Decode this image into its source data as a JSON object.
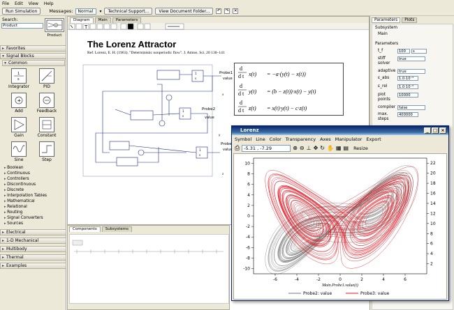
{
  "menu": [
    "File",
    "Edit",
    "View",
    "Help"
  ],
  "toolbar": {
    "run_label": "Run Simulation",
    "messages_label": "Messages:",
    "messages_value": "Normal",
    "tech_support_label": "Technical Support...",
    "view_doc_label": "View Document Folder..."
  },
  "left": {
    "search_label": "Search:",
    "search_value": "Product",
    "product_label": "Product",
    "favorites": "Favorites",
    "signal_blocks": "Signal Blocks",
    "common": "Common",
    "blocks": [
      "Integrator",
      "PID",
      "Add",
      "Feedback",
      "Gain",
      "Constant",
      "Sine",
      "Step"
    ],
    "tree": [
      "Boolean",
      "Continuous",
      "Controllers",
      "Discontinuous",
      "Discrete",
      "Interpolation Tables",
      "Mathematical",
      "Relational",
      "Routing",
      "Signal Converters",
      "Sources"
    ],
    "sections": [
      "Electrical",
      "1-D Mechanical",
      "Multibody",
      "Thermal",
      "Examples"
    ]
  },
  "canvas": {
    "tabs": [
      "Diagram",
      "Main",
      "Parameters"
    ],
    "title": "The Lorenz Attractor",
    "reference": "Ref. Lorenz, E. H. (1963). \"Deterministic nonperiodic flow\". J. Atmos. Sci. 20 130–141",
    "eq1_lhs": "x(t)",
    "eq1_rhs": "= −a·(y(t) − x(t))",
    "eq2_lhs": "y(t)",
    "eq2_rhs": "= (b − z(t))·x(t) − y(t)",
    "eq3_lhs": "z(t)",
    "eq3_rhs": "= x(t)·y(t) − c·z(t)",
    "probe1": "Probe1",
    "probe2": "Probe2",
    "probe3": "Probe3",
    "value": "value",
    "bottom_tabs": [
      "Components",
      "Subsystems"
    ]
  },
  "right": {
    "tabs": [
      "Parameters",
      "Plots"
    ],
    "subsystem": "Subsystem",
    "main": "Main",
    "parameters_header": "Parameters",
    "rows": [
      {
        "label": "t_f",
        "value": "100",
        "unit": "s"
      },
      {
        "label": "stiff solver",
        "value": "true"
      },
      {
        "label": "adaptive",
        "value": "true"
      },
      {
        "label": "ε_abs",
        "value": "1.0·10⁻⁵"
      },
      {
        "label": "ε_rel",
        "value": "1.0·10⁻⁵"
      },
      {
        "label": "plot points",
        "value": "10000"
      },
      {
        "label": "compiler",
        "value": "false"
      },
      {
        "label": "max. steps",
        "value": "400000"
      }
    ]
  },
  "lorenz": {
    "title": "Lorenz",
    "menu": [
      "Symbol",
      "Line",
      "Color",
      "Transparency",
      "Axes",
      "Manipulator",
      "Export"
    ],
    "coord": "-5.31 , -7.29",
    "resize": "Resize",
    "colors": {
      "probe2": "#777777",
      "probe3": "#e0141e"
    }
  },
  "chart_data": {
    "type": "line",
    "title": "",
    "xlabel": "Main.Probe1.value(t)",
    "ylabel": "",
    "xlim": [
      -8,
      8
    ],
    "ylim_left": [
      -11,
      11
    ],
    "ylim_right": [
      0,
      23
    ],
    "xticks": [
      -6,
      -4,
      -2,
      0,
      2,
      4,
      6
    ],
    "yticks_left": [
      -10,
      -8,
      -6,
      -4,
      -2,
      0,
      2,
      4,
      6,
      8,
      10
    ],
    "yticks_right": [
      2,
      4,
      6,
      8,
      10,
      12,
      14,
      16,
      18,
      20,
      22
    ],
    "legend": "bottom",
    "series": [
      {
        "name": "Probe2: value",
        "color": "#777777",
        "axis": "left",
        "lorenz_coords": "x_y",
        "rho": 28,
        "sigma": 10,
        "beta": 2.667
      },
      {
        "name": "Probe3: value",
        "color": "#e0141e",
        "axis": "right",
        "lorenz_coords": "x_z",
        "rho": 28,
        "sigma": 10,
        "beta": 2.667
      }
    ]
  }
}
